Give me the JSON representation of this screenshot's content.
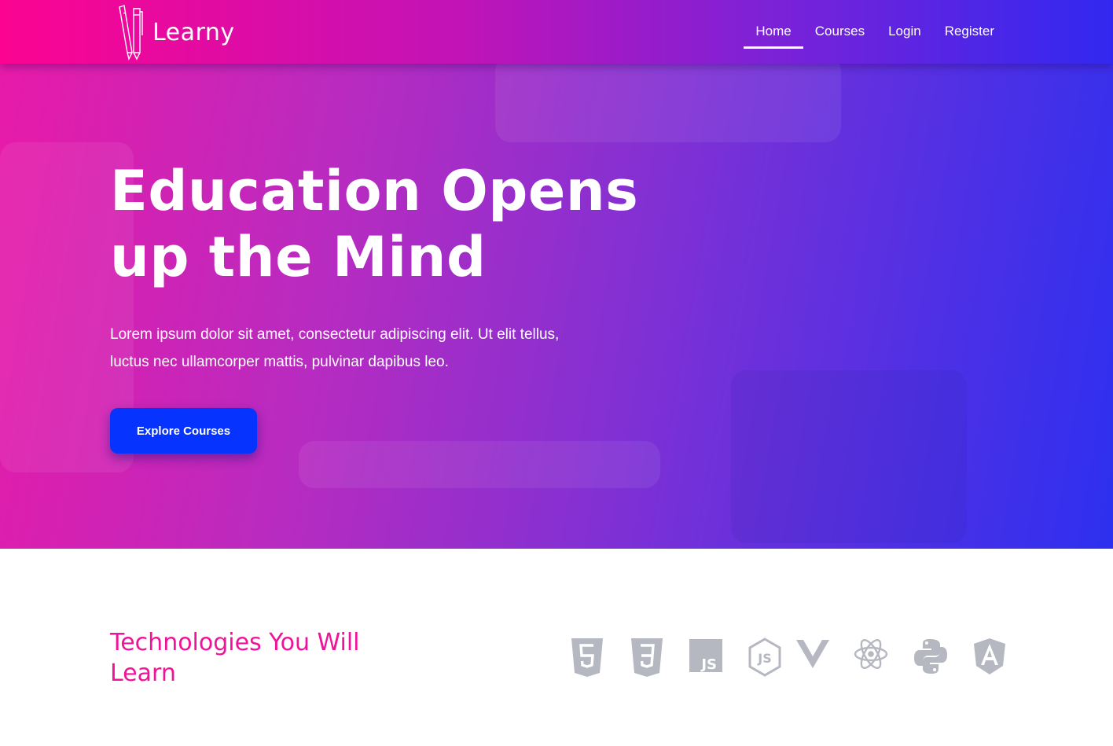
{
  "navbar": {
    "brand": "Learny",
    "items": [
      {
        "label": "Home",
        "active": true
      },
      {
        "label": "Courses",
        "active": false
      },
      {
        "label": "Login",
        "active": false
      },
      {
        "label": "Register",
        "active": false
      }
    ]
  },
  "hero": {
    "title": "Education Opens up the Mind",
    "text": "Lorem ipsum dolor sit amet, consectetur adipiscing elit. Ut elit tellus, luctus nec ullamcorper mattis, pulvinar dapibus leo.",
    "cta": "Explore Courses"
  },
  "technologies": {
    "title": "Technologies You Will Learn",
    "icons": [
      "html5-icon",
      "css3-icon",
      "javascript-icon",
      "nodejs-icon",
      "vue-icon",
      "react-icon",
      "python-icon",
      "angular-icon"
    ]
  },
  "colors": {
    "gradient_start": "#fc0491",
    "gradient_end": "#3128f0",
    "button": "#0733ff",
    "accent_title": "#f1129a",
    "icon_gray": "#b5b8c0"
  }
}
